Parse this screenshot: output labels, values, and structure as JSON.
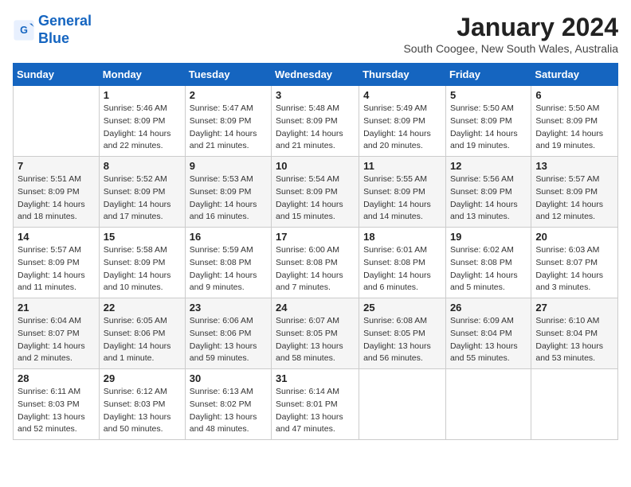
{
  "header": {
    "logo_line1": "General",
    "logo_line2": "Blue",
    "month_title": "January 2024",
    "subtitle": "South Coogee, New South Wales, Australia"
  },
  "weekdays": [
    "Sunday",
    "Monday",
    "Tuesday",
    "Wednesday",
    "Thursday",
    "Friday",
    "Saturday"
  ],
  "weeks": [
    [
      {
        "day": "",
        "detail": ""
      },
      {
        "day": "1",
        "detail": "Sunrise: 5:46 AM\nSunset: 8:09 PM\nDaylight: 14 hours\nand 22 minutes."
      },
      {
        "day": "2",
        "detail": "Sunrise: 5:47 AM\nSunset: 8:09 PM\nDaylight: 14 hours\nand 21 minutes."
      },
      {
        "day": "3",
        "detail": "Sunrise: 5:48 AM\nSunset: 8:09 PM\nDaylight: 14 hours\nand 21 minutes."
      },
      {
        "day": "4",
        "detail": "Sunrise: 5:49 AM\nSunset: 8:09 PM\nDaylight: 14 hours\nand 20 minutes."
      },
      {
        "day": "5",
        "detail": "Sunrise: 5:50 AM\nSunset: 8:09 PM\nDaylight: 14 hours\nand 19 minutes."
      },
      {
        "day": "6",
        "detail": "Sunrise: 5:50 AM\nSunset: 8:09 PM\nDaylight: 14 hours\nand 19 minutes."
      }
    ],
    [
      {
        "day": "7",
        "detail": "Sunrise: 5:51 AM\nSunset: 8:09 PM\nDaylight: 14 hours\nand 18 minutes."
      },
      {
        "day": "8",
        "detail": "Sunrise: 5:52 AM\nSunset: 8:09 PM\nDaylight: 14 hours\nand 17 minutes."
      },
      {
        "day": "9",
        "detail": "Sunrise: 5:53 AM\nSunset: 8:09 PM\nDaylight: 14 hours\nand 16 minutes."
      },
      {
        "day": "10",
        "detail": "Sunrise: 5:54 AM\nSunset: 8:09 PM\nDaylight: 14 hours\nand 15 minutes."
      },
      {
        "day": "11",
        "detail": "Sunrise: 5:55 AM\nSunset: 8:09 PM\nDaylight: 14 hours\nand 14 minutes."
      },
      {
        "day": "12",
        "detail": "Sunrise: 5:56 AM\nSunset: 8:09 PM\nDaylight: 14 hours\nand 13 minutes."
      },
      {
        "day": "13",
        "detail": "Sunrise: 5:57 AM\nSunset: 8:09 PM\nDaylight: 14 hours\nand 12 minutes."
      }
    ],
    [
      {
        "day": "14",
        "detail": "Sunrise: 5:57 AM\nSunset: 8:09 PM\nDaylight: 14 hours\nand 11 minutes."
      },
      {
        "day": "15",
        "detail": "Sunrise: 5:58 AM\nSunset: 8:09 PM\nDaylight: 14 hours\nand 10 minutes."
      },
      {
        "day": "16",
        "detail": "Sunrise: 5:59 AM\nSunset: 8:08 PM\nDaylight: 14 hours\nand 9 minutes."
      },
      {
        "day": "17",
        "detail": "Sunrise: 6:00 AM\nSunset: 8:08 PM\nDaylight: 14 hours\nand 7 minutes."
      },
      {
        "day": "18",
        "detail": "Sunrise: 6:01 AM\nSunset: 8:08 PM\nDaylight: 14 hours\nand 6 minutes."
      },
      {
        "day": "19",
        "detail": "Sunrise: 6:02 AM\nSunset: 8:08 PM\nDaylight: 14 hours\nand 5 minutes."
      },
      {
        "day": "20",
        "detail": "Sunrise: 6:03 AM\nSunset: 8:07 PM\nDaylight: 14 hours\nand 3 minutes."
      }
    ],
    [
      {
        "day": "21",
        "detail": "Sunrise: 6:04 AM\nSunset: 8:07 PM\nDaylight: 14 hours\nand 2 minutes."
      },
      {
        "day": "22",
        "detail": "Sunrise: 6:05 AM\nSunset: 8:06 PM\nDaylight: 14 hours\nand 1 minute."
      },
      {
        "day": "23",
        "detail": "Sunrise: 6:06 AM\nSunset: 8:06 PM\nDaylight: 13 hours\nand 59 minutes."
      },
      {
        "day": "24",
        "detail": "Sunrise: 6:07 AM\nSunset: 8:05 PM\nDaylight: 13 hours\nand 58 minutes."
      },
      {
        "day": "25",
        "detail": "Sunrise: 6:08 AM\nSunset: 8:05 PM\nDaylight: 13 hours\nand 56 minutes."
      },
      {
        "day": "26",
        "detail": "Sunrise: 6:09 AM\nSunset: 8:04 PM\nDaylight: 13 hours\nand 55 minutes."
      },
      {
        "day": "27",
        "detail": "Sunrise: 6:10 AM\nSunset: 8:04 PM\nDaylight: 13 hours\nand 53 minutes."
      }
    ],
    [
      {
        "day": "28",
        "detail": "Sunrise: 6:11 AM\nSunset: 8:03 PM\nDaylight: 13 hours\nand 52 minutes."
      },
      {
        "day": "29",
        "detail": "Sunrise: 6:12 AM\nSunset: 8:03 PM\nDaylight: 13 hours\nand 50 minutes."
      },
      {
        "day": "30",
        "detail": "Sunrise: 6:13 AM\nSunset: 8:02 PM\nDaylight: 13 hours\nand 48 minutes."
      },
      {
        "day": "31",
        "detail": "Sunrise: 6:14 AM\nSunset: 8:01 PM\nDaylight: 13 hours\nand 47 minutes."
      },
      {
        "day": "",
        "detail": ""
      },
      {
        "day": "",
        "detail": ""
      },
      {
        "day": "",
        "detail": ""
      }
    ]
  ]
}
